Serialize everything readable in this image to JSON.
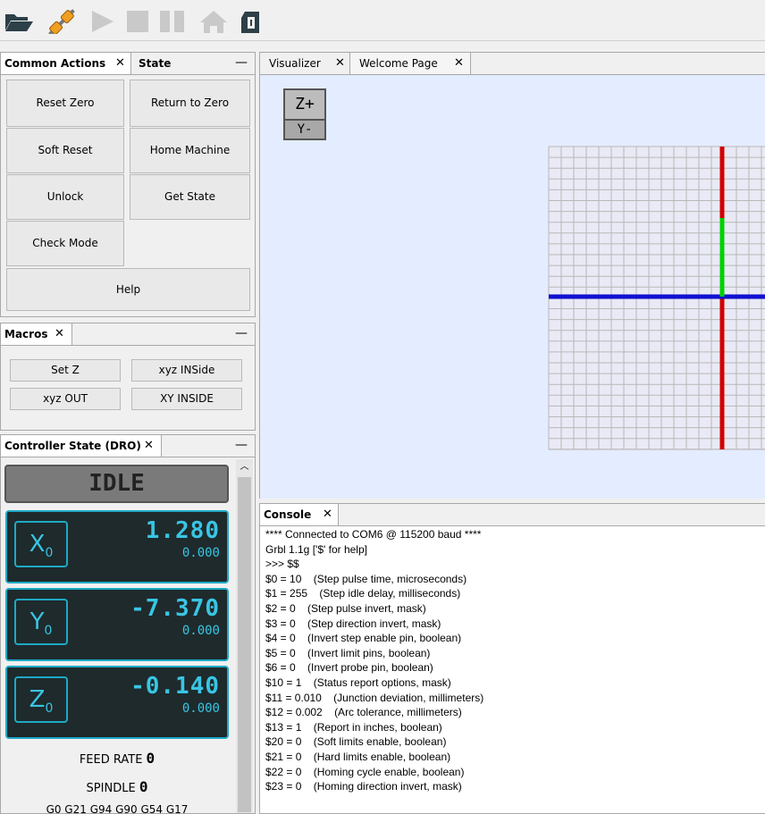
{
  "toolbar": {
    "icons": [
      "folder-open-icon",
      "plug-connect-icon",
      "play-icon",
      "stop-icon",
      "pause-icon",
      "home-icon",
      "machine-icon"
    ]
  },
  "common_actions": {
    "tab_label": "Common Actions",
    "state_tab_label": "State",
    "buttons": {
      "reset_zero": "Reset Zero",
      "return_to_zero": "Return to Zero",
      "soft_reset": "Soft Reset",
      "home_machine": "Home Machine",
      "unlock": "Unlock",
      "get_state": "Get State",
      "check_mode": "Check Mode",
      "help": "Help"
    }
  },
  "macros": {
    "tab_label": "Macros",
    "buttons": {
      "set_z": "Set Z",
      "xyz_inside": "xyz INSide",
      "xyz_out": "xyz OUT",
      "xy_inside": "XY INSIDE"
    }
  },
  "dro": {
    "tab_label": "Controller State (DRO)",
    "state": "IDLE",
    "axes": [
      {
        "axis": "X",
        "sub": "0",
        "work": "1.280",
        "machine": "0.000"
      },
      {
        "axis": "Y",
        "sub": "0",
        "work": "-7.370",
        "machine": "0.000"
      },
      {
        "axis": "Z",
        "sub": "0",
        "work": "-0.140",
        "machine": "0.000"
      }
    ],
    "feed_label": "FEED RATE",
    "feed_value": "0",
    "spindle_label": "SPINDLE",
    "spindle_value": "0",
    "gcode_state": "G0 G21 G94 G90 G54 G17"
  },
  "visualizer": {
    "tab_label": "Visualizer",
    "welcome_tab_label": "Welcome Page",
    "view_zplus": "Z+",
    "view_yminus": "Y-",
    "colors": {
      "background": "#e4ecff",
      "x_axis": "#1010d0",
      "y_axis": "#d00000",
      "z_axis": "#00d000",
      "grid": "#b8b8b8"
    }
  },
  "console": {
    "tab_label": "Console",
    "lines": [
      "**** Connected to COM6 @ 115200 baud ****",
      "Grbl 1.1g ['$' for help]",
      ">>> $$",
      "$0 = 10    (Step pulse time, microseconds)",
      "$1 = 255    (Step idle delay, milliseconds)",
      "$2 = 0    (Step pulse invert, mask)",
      "$3 = 0    (Step direction invert, mask)",
      "$4 = 0    (Invert step enable pin, boolean)",
      "$5 = 0    (Invert limit pins, boolean)",
      "$6 = 0    (Invert probe pin, boolean)",
      "$10 = 1    (Status report options, mask)",
      "$11 = 0.010    (Junction deviation, millimeters)",
      "$12 = 0.002    (Arc tolerance, millimeters)",
      "$13 = 1    (Report in inches, boolean)",
      "$20 = 0    (Soft limits enable, boolean)",
      "$21 = 0    (Hard limits enable, boolean)",
      "$22 = 0    (Homing cycle enable, boolean)",
      "$23 = 0    (Homing direction invert, mask)"
    ]
  }
}
